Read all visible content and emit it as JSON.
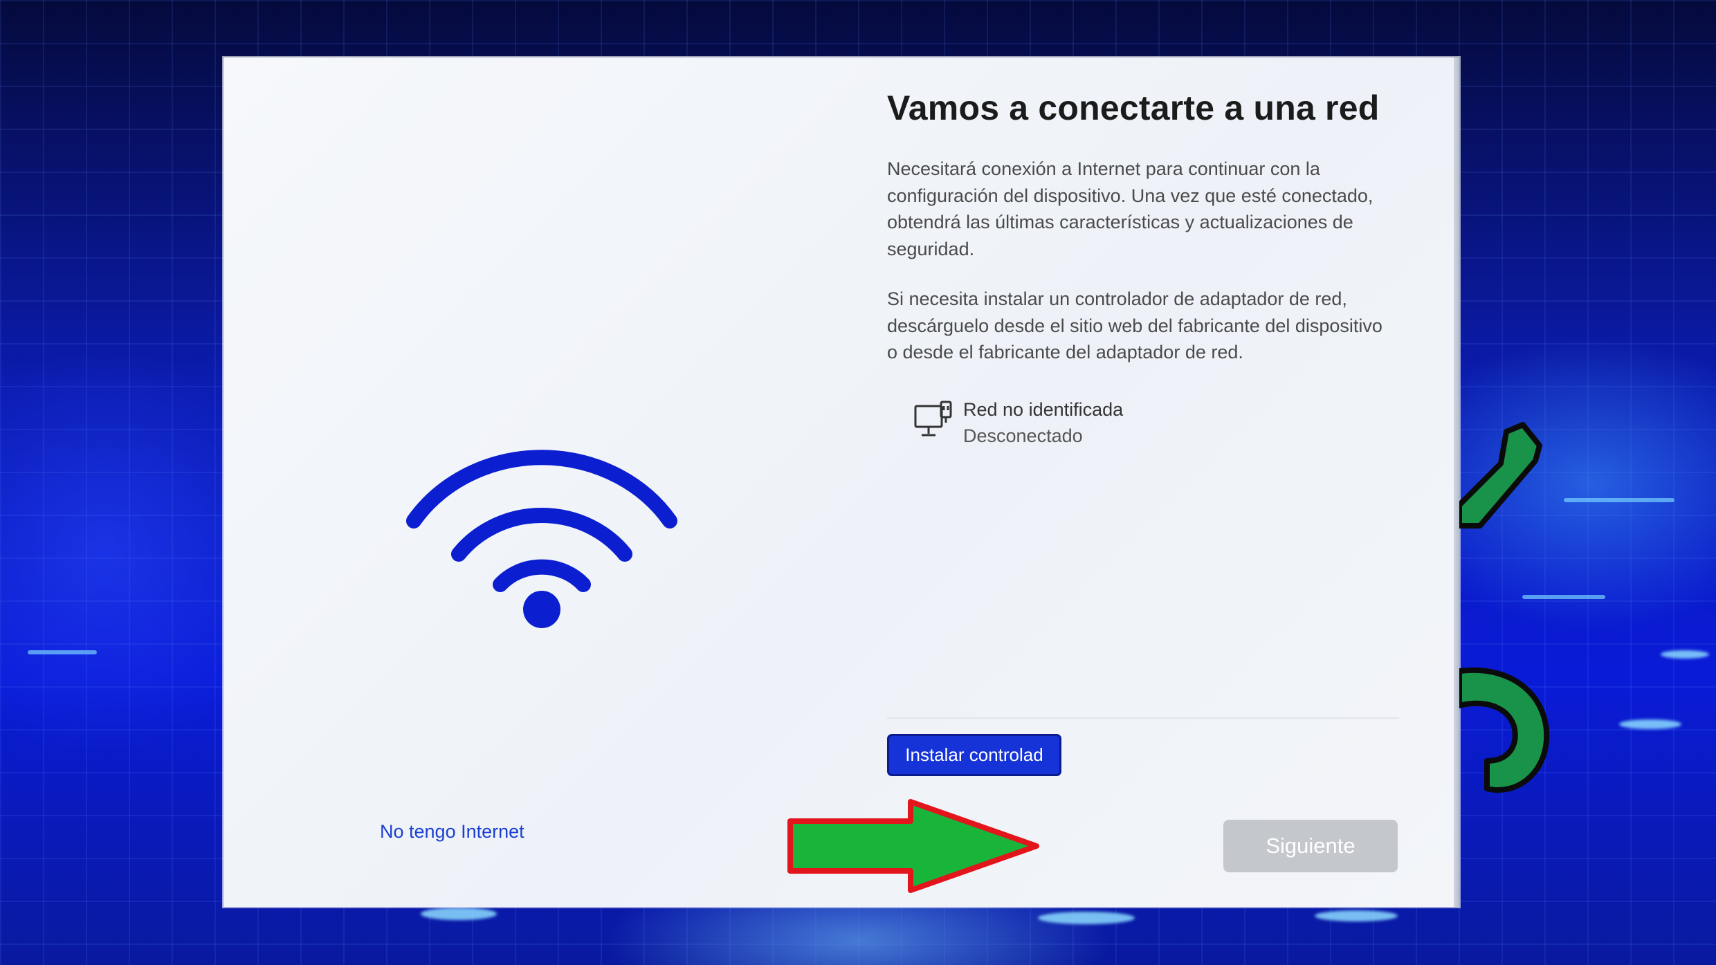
{
  "setup": {
    "title": "Vamos a conectarte a una red",
    "paragraphs": [
      "Necesitará conexión a Internet para continuar con la configuración del dispositivo. Una vez que esté conectado, obtendrá las últimas características y actualizaciones de seguridad.",
      "Si necesita instalar un controlador de adaptador de red, descárguelo desde el sitio web del fabricante del dispositivo o desde el fabricante del adaptador de red."
    ],
    "network": {
      "icon": "wired-network-icon",
      "name": "Red no identificada",
      "status": "Desconectado"
    },
    "buttons": {
      "install_label": "Instalar controlad",
      "no_internet_label": "No tengo Internet",
      "next_label": "Siguiente"
    },
    "hero_icon": "wifi-icon"
  },
  "overlays": {
    "arrow": {
      "icon": "green-arrow-icon",
      "fill": "#19b53a",
      "outline": "#e3151c"
    },
    "wrench": {
      "icon": "wrench-icon",
      "fill": "#19934a"
    }
  },
  "colors": {
    "accent": "#1533d6",
    "link": "#1b3fd1",
    "disabled_button": "#c4c7cc",
    "wifi": "#0b1fd0"
  }
}
